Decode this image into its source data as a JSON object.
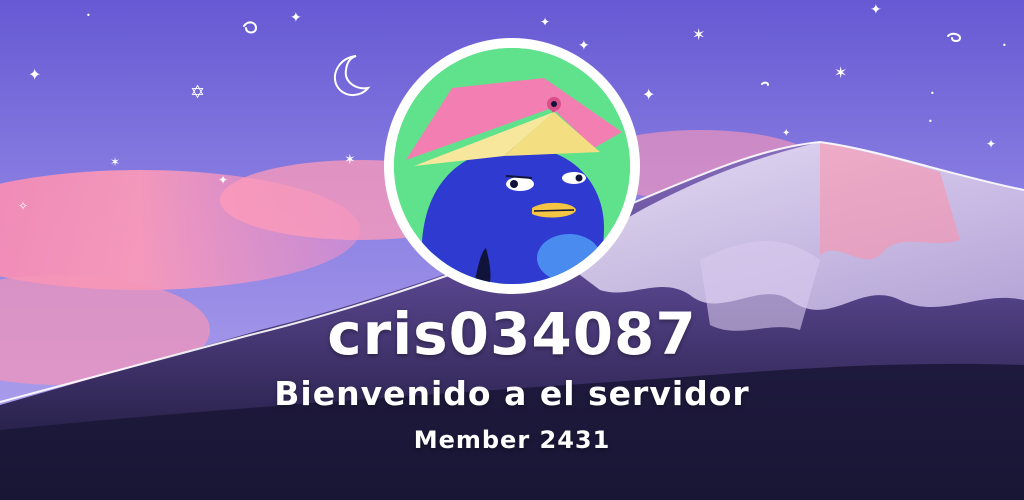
{
  "welcome_card": {
    "username": "cris034087",
    "greeting": "Bienvenido a el servidor",
    "member_count": "Member 2431"
  },
  "colors": {
    "sky_top": "#6f62d8",
    "sky_mid": "#9a8ae6",
    "cloud_pink": "#ff8fb0",
    "mountain_dark": "#1c1838",
    "snow": "#e9e3f5",
    "avatar_bg": "#5fe28b",
    "avatar_character": "#2f3ad1",
    "text": "#ffffff"
  },
  "icons": {
    "avatar": "bird-wearing-book-avatar",
    "decor": [
      "star-doodles",
      "crescent-moon-doodle",
      "swirl-doodles"
    ]
  }
}
